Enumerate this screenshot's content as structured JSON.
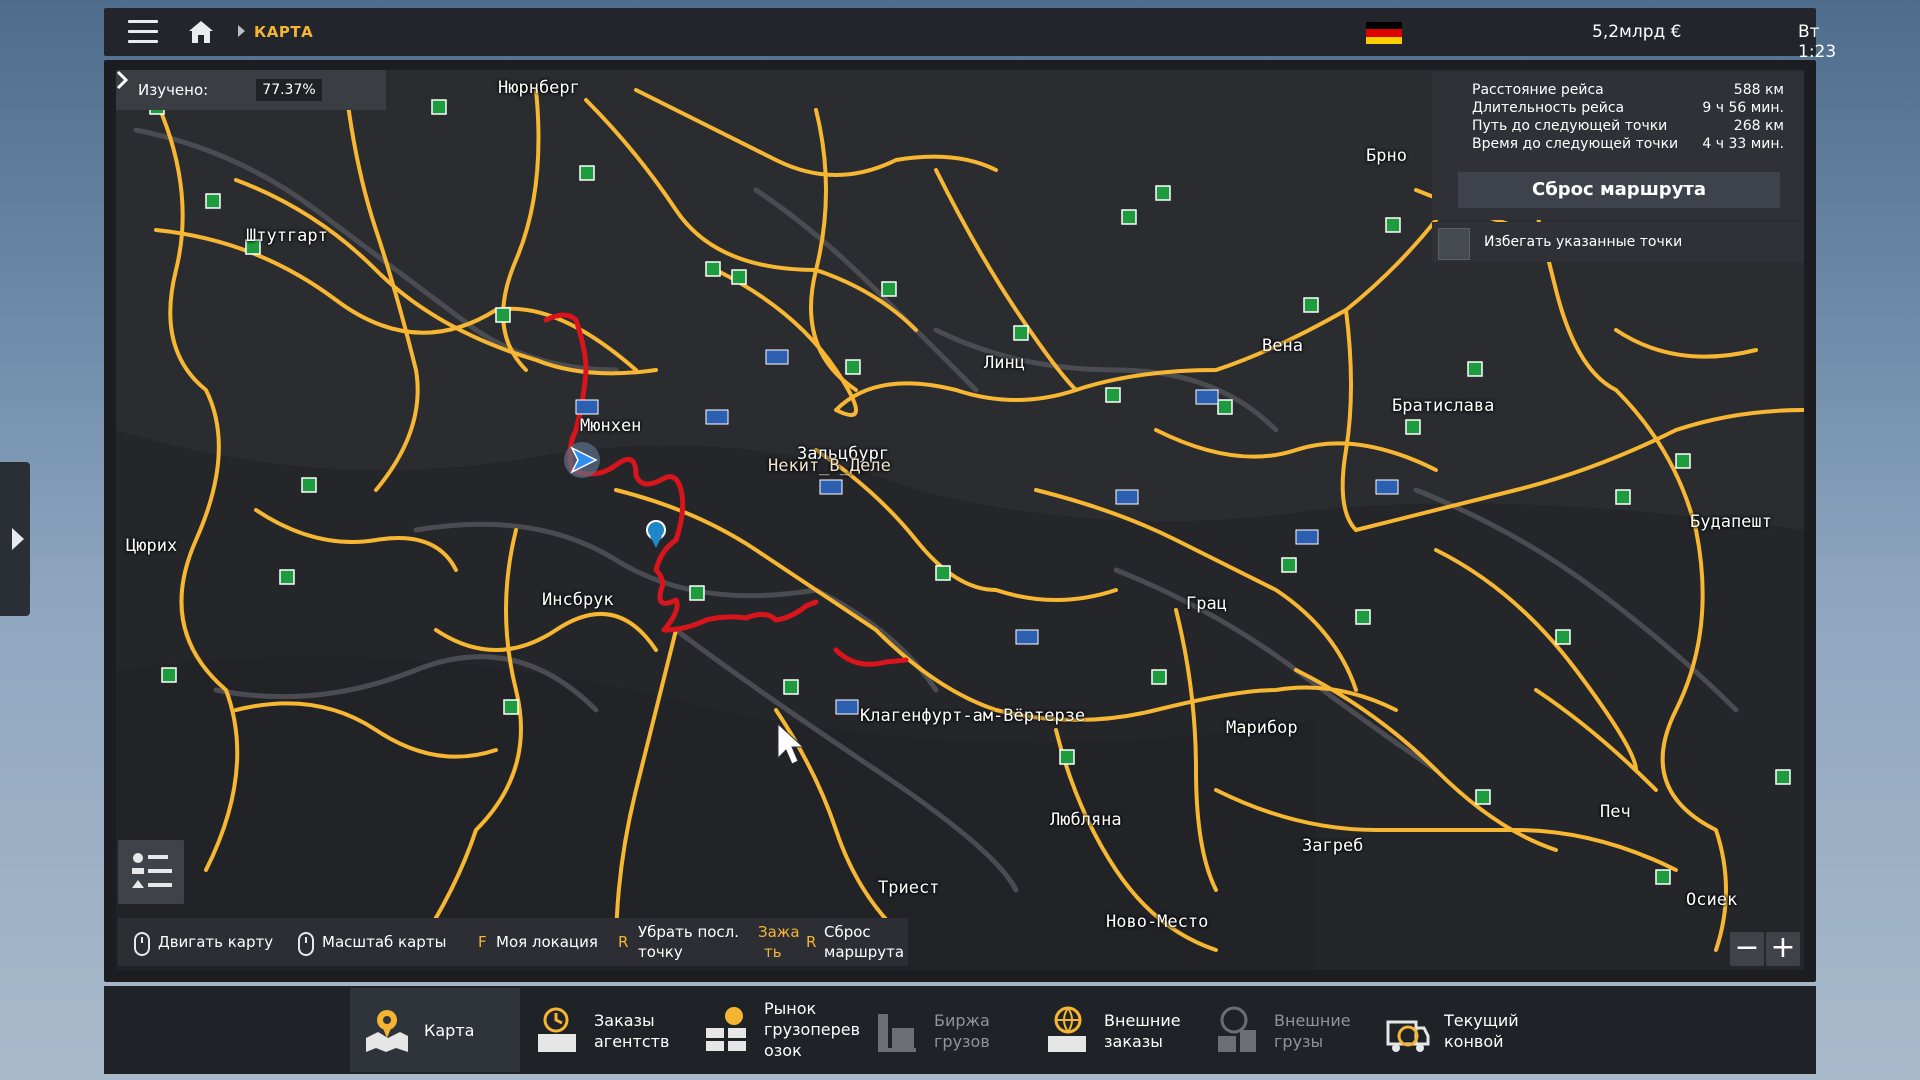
{
  "topbar": {
    "breadcrumb": "КАРТА",
    "money": "5,2млрд €",
    "time": "Вт 1:23"
  },
  "explored": {
    "label": "Изучено:",
    "value": "77.37%"
  },
  "route_panel": {
    "rows": [
      {
        "label": "Расстояние рейса",
        "value": "588 км"
      },
      {
        "label": "Длительность рейса",
        "value": "9 ч 56 мин."
      },
      {
        "label": "Путь до следующей точки",
        "value": "268 км"
      },
      {
        "label": "Время до следующей точки",
        "value": "4 ч 33 мин."
      }
    ],
    "reset_button": "Сброс маршрута",
    "avoid_label": "Избегать указанные точки"
  },
  "player_label": "Некит_В_Деле",
  "cities": [
    "Нюрнберг",
    "Штутгарт",
    "Мюнхен",
    "Зальцбург",
    "Линц",
    "Вена",
    "Брно",
    "Братислава",
    "Будапешт",
    "Цюрих",
    "Инсбрук",
    "Грац",
    "Клагенфурт-ам-Вёртерзе",
    "Марибор",
    "Любляна",
    "Загреб",
    "Печ",
    "Осиек",
    "Триест",
    "Ново-Место"
  ],
  "hints": {
    "move_map": "Двигать карту",
    "zoom_map": "Масштаб карты",
    "my_location_key": "F",
    "my_location": "Моя локация",
    "remove_point_key": "R",
    "remove_point_line1": "Убрать посл.",
    "remove_point_line2": "точку",
    "hold_key_line1": "Зажа",
    "hold_key_line2": "ть",
    "hold_key_r": "R",
    "reset_route_line1": "Сброс",
    "reset_route_line2": "маршрута"
  },
  "zoom": {
    "out": "−",
    "in": "+"
  },
  "nav": [
    {
      "label1": "Карта",
      "label2": ""
    },
    {
      "label1": "Заказы",
      "label2": "агентств"
    },
    {
      "label1": "Рынок",
      "label2": "грузоперев",
      "label3": "озок"
    },
    {
      "label1": "Биржа",
      "label2": "грузов"
    },
    {
      "label1": "Внешние",
      "label2": "заказы"
    },
    {
      "label1": "Внешние",
      "label2": "грузы"
    },
    {
      "label1": "Текущий",
      "label2": "конвой"
    }
  ],
  "colors": {
    "accent": "#f5b533",
    "road": "#f7b733",
    "route": "#d8141c",
    "depot": "#1e9b3e",
    "map_bg": "#2b2c30"
  },
  "icons": [
    "menu-icon",
    "home-icon",
    "germany-flag-icon",
    "truck-marker-icon",
    "waypoint-pin-icon",
    "cursor-arrow-icon",
    "mouse-icon",
    "legend-list-icon",
    "map-icon",
    "clock-icon",
    "market-icon",
    "exchange-icon",
    "globe-icon",
    "convoy-icon"
  ]
}
